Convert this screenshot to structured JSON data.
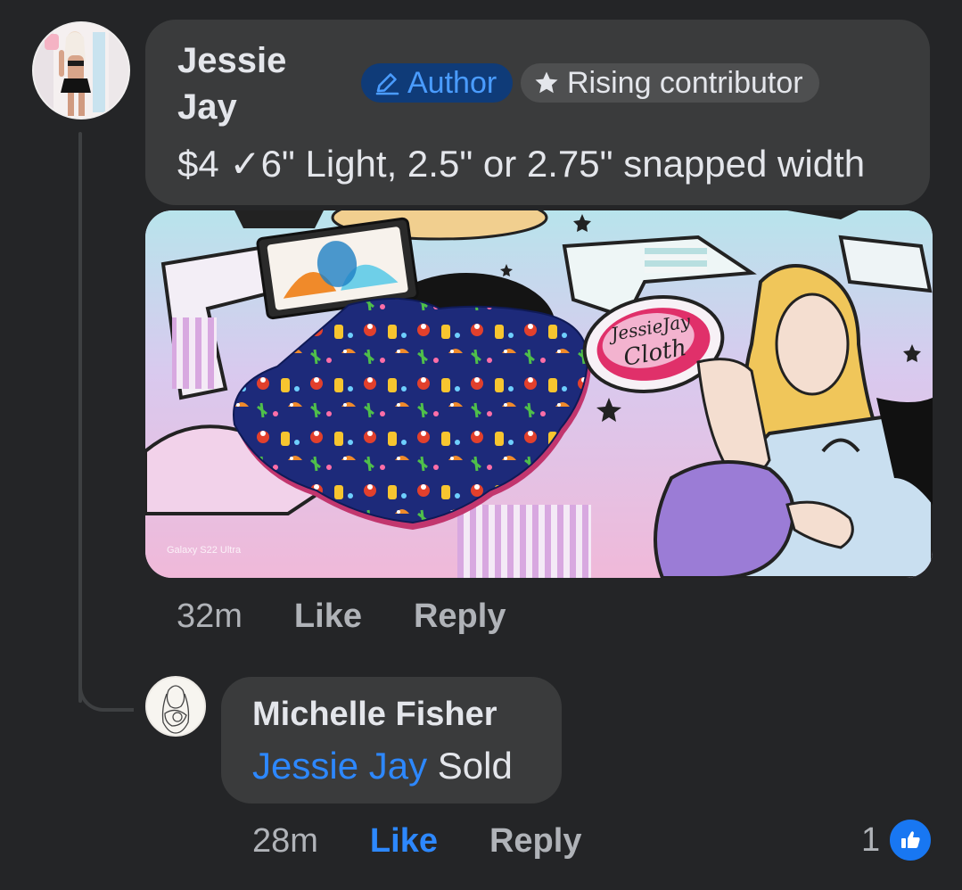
{
  "comment": {
    "author": "Jessie\nJay",
    "author_line1": "Jessie",
    "author_line2": "Jay",
    "badges": {
      "author": "Author",
      "author_icon": "pencil-icon",
      "contributor": "Rising contributor",
      "contributor_icon": "star-icon"
    },
    "text": "$4 ✓6\" Light, 2.5\" or 2.75\" snapped width",
    "attachment_watermark": "Galaxy S22 Ultra",
    "attachment_logo_text_1": "JessieJay",
    "attachment_logo_text_2": "Cloth",
    "time": "32m",
    "like_label": "Like",
    "reply_label": "Reply"
  },
  "reply": {
    "author": "Michelle Fisher",
    "mention": "Jessie Jay",
    "text": " Sold",
    "time": "28m",
    "like_label": "Like",
    "reply_label": "Reply",
    "liked": true,
    "reaction_count": "1",
    "reaction_icon": "thumbs-up-icon"
  },
  "colors": {
    "background": "#242527",
    "bubble": "#3a3b3c",
    "accent_blue": "#2d88ff",
    "author_badge_bg": "#0f3b78",
    "muted_text": "#b0b3b8"
  }
}
